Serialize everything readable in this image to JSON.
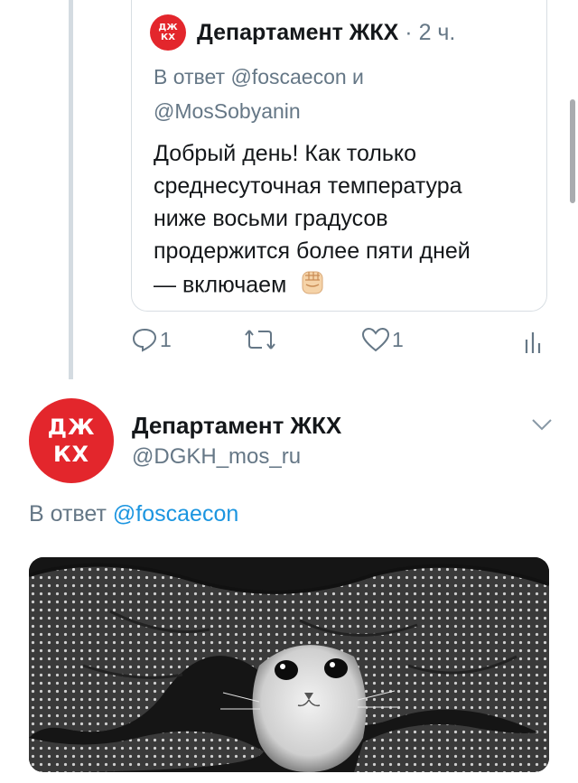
{
  "quoted_tweet": {
    "avatar_text": [
      "ДЖ",
      "КХ"
    ],
    "author_name": "Департамент ЖКХ",
    "separator": "·",
    "time": "2 ч.",
    "reply_to_line1": "В ответ @foscaecon и",
    "reply_to_line2": "@MosSobyanin",
    "body_lines": [
      "Добрый день! Как только",
      "среднесуточная температура",
      "ниже восьми градусов",
      "продержится более пяти дней",
      "— включаем"
    ],
    "emoji": "fist-emoji"
  },
  "actions": {
    "reply_count": "1",
    "like_count": "1",
    "icons": [
      "reply-icon",
      "retweet-icon",
      "like-icon",
      "analytics-icon"
    ]
  },
  "main_tweet": {
    "avatar_text": [
      "ДЖ",
      "КХ"
    ],
    "author_name": "Департамент ЖКХ",
    "handle": "@DGKH_mos_ru",
    "reply_prefix": "В ответ",
    "reply_mention": "@foscaecon",
    "media": "photo of a cat peeking out from under a quilted blanket (black and white)"
  },
  "colors": {
    "brand_red": "#e3262c",
    "muted_text": "#657786",
    "link_blue": "#1b95e0",
    "thread_line": "#d4dbe1"
  }
}
